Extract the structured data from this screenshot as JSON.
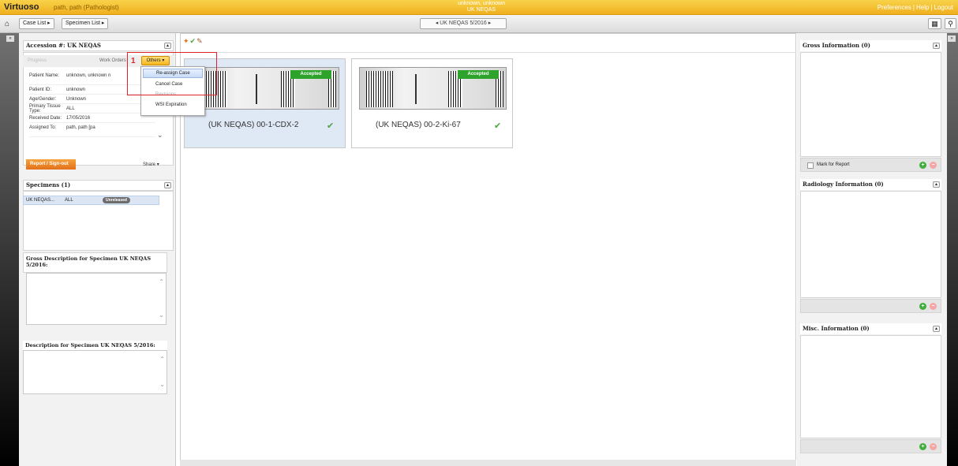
{
  "header": {
    "app_name": "Virtuoso",
    "user": "path, path (Pathologist)",
    "patient_name": "unknown, unknown",
    "patient_case": "UK NEQAS",
    "links": [
      "Preferences",
      "Help",
      "Logout"
    ]
  },
  "nav": {
    "home_icon": "home-icon",
    "case_list": "Case List",
    "specimen_list": "Specimen List",
    "case_selector": "UK NEQAS 5/2016"
  },
  "accession": {
    "title": "Accession #: UK NEQAS",
    "progress_tab": "Progress",
    "work_orders_tab": "Work Orders",
    "others_button": "Others",
    "annotation_number": "1",
    "fields": [
      {
        "label": "Patient Name:",
        "value": "unknown, unknown n"
      },
      {
        "label": "Patient ID:",
        "value": "unknown"
      },
      {
        "label": "Age/Gender:",
        "value": "Unknown"
      },
      {
        "label": "Primary Tissue Type:",
        "value": "ALL"
      },
      {
        "label": "Received Date:",
        "value": "17/05/2016"
      },
      {
        "label": "Assigned To:",
        "value": "path, path [pa"
      }
    ],
    "report_button": "Report / Sign-out",
    "share_button": "Share"
  },
  "others_menu": {
    "items": [
      {
        "label": "Re-assign Case",
        "state": "active"
      },
      {
        "label": "Cancel Case",
        "state": "normal"
      },
      {
        "label": "Revisions",
        "state": "disabled"
      },
      {
        "label": "WSI Expiration",
        "state": "normal"
      }
    ]
  },
  "specimens": {
    "title": "Specimens (1)",
    "rows": [
      {
        "name": "UK NEQAS...",
        "tissue": "ALL",
        "status": "Unreleased"
      }
    ],
    "gross_description_title": "Gross Description for Specimen UK NEQAS 5/2016:",
    "description_title": "Description for Specimen UK NEQAS 5/2016:"
  },
  "slides": [
    {
      "label": "(UK NEQAS) 00-1-CDX-2",
      "status": "Accepted",
      "selected": true
    },
    {
      "label": "(UK NEQAS) 00-2-Ki-67",
      "status": "Accepted",
      "selected": false
    }
  ],
  "right_panels": {
    "gross_info": "Gross Information (0)",
    "mark_for_report": "Mark for Report",
    "radiology_info": "Radiology Information (0)",
    "misc_info": "Misc. Information (0)"
  },
  "colors": {
    "brand_orange": "#f0b01e",
    "accepted_green": "#2ea32c",
    "report_orange": "#e4701a",
    "annotation_red": "#e0232c"
  }
}
